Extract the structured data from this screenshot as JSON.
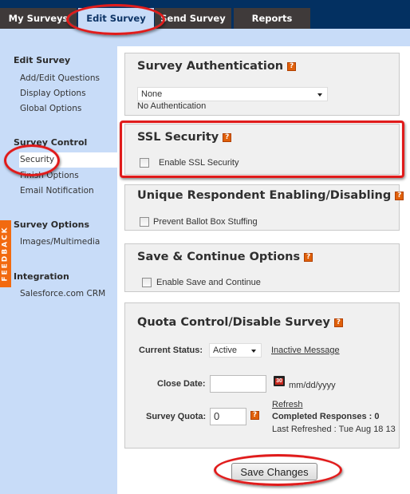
{
  "nav": {
    "tabs": [
      {
        "label": "My Surveys",
        "active": false
      },
      {
        "label": "Edit Survey",
        "active": true
      },
      {
        "label": "Send Survey",
        "active": false
      },
      {
        "label": "Reports",
        "active": false
      }
    ]
  },
  "sidebar": {
    "sections": [
      {
        "heading": "Edit Survey",
        "items": [
          "Add/Edit Questions",
          "Display Options",
          "Global Options"
        ]
      },
      {
        "heading": "Survey Control",
        "items": [
          "Security",
          "Finish Options",
          "Email Notification"
        ],
        "selected": "Security"
      },
      {
        "heading": "Survey Options",
        "items": [
          "Images/Multimedia"
        ]
      },
      {
        "heading": "Integration",
        "items": [
          "Salesforce.com CRM"
        ]
      }
    ],
    "feedback_label": "FEEDBACK"
  },
  "panels": {
    "authentication": {
      "title": "Survey Authentication",
      "select_value": "None",
      "description": "No Authentication"
    },
    "ssl": {
      "title": "SSL Security",
      "checkbox_label": "Enable SSL Security",
      "checked": false
    },
    "unique": {
      "title": "Unique Respondent Enabling/Disabling",
      "checkbox_label": "Prevent Ballot Box Stuffing",
      "checked": false
    },
    "save_continue": {
      "title": "Save & Continue Options",
      "checkbox_label": "Enable Save and Continue",
      "checked": false
    },
    "quota": {
      "title": "Quota Control/Disable Survey",
      "status_label": "Current Status:",
      "status_value": "Active",
      "inactive_link": "Inactive Message",
      "close_date_label": "Close Date:",
      "close_date_value": "",
      "date_format": "mm/dd/yyyy",
      "calendar_icon_text": "30",
      "quota_label": "Survey Quota:",
      "quota_value": "0",
      "refresh_link": "Refresh",
      "completed_responses": "Completed Responses : 0",
      "last_refreshed": "Last Refreshed : Tue Aug 18 13"
    }
  },
  "help_glyph": "?",
  "actions": {
    "save_label": "Save Changes"
  },
  "colors": {
    "topbar": "#033061",
    "tab_inactive": "#3f3a3a",
    "tab_active": "#c8dcf8",
    "sidebar_bg": "#c8dcf8",
    "panel_bg": "#f0f0f0",
    "help_orange": "#e0600a",
    "feedback_orange": "#f26a10",
    "highlight_red": "#e01b1b"
  }
}
